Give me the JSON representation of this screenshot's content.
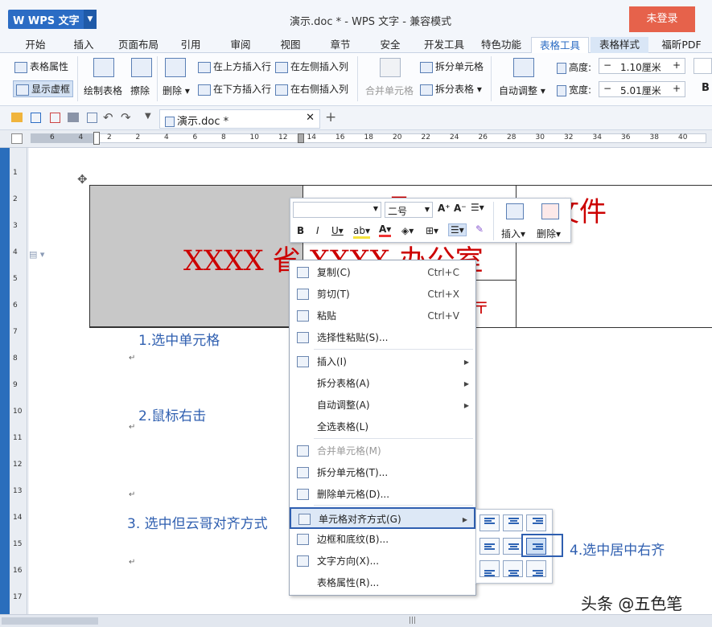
{
  "app": {
    "name": "WPS 文字",
    "document_title": "演示.doc * - WPS 文字 - 兼容模式",
    "login": "未登录"
  },
  "tabs": [
    "开始",
    "插入",
    "页面布局",
    "引用",
    "审阅",
    "视图",
    "章节",
    "安全",
    "开发工具",
    "特色功能",
    "表格工具",
    "表格样式",
    "福昕PDF"
  ],
  "ribbon": {
    "table_props": "表格属性",
    "show_gridlines": "显示虚框",
    "draw_table": "绘制表格",
    "erase": "擦除",
    "delete": "删除",
    "insert_above": "在上方插入行",
    "insert_below": "在下方插入行",
    "insert_left": "在左侧插入列",
    "insert_right": "在右侧插入列",
    "merge_cells": "合并单元格",
    "split_cells": "拆分单元格",
    "split_table": "拆分表格",
    "autofit": "自动调整",
    "height_label": "高度:",
    "height_value": "1.10厘米",
    "width_label": "宽度:",
    "width_value": "5.01厘米"
  },
  "doc_tab": "演示.doc *",
  "ruler": {
    "h": [
      "6",
      "4",
      "2",
      "2",
      "4",
      "6",
      "8",
      "10",
      "12",
      "14",
      "16",
      "18",
      "20",
      "22",
      "24",
      "26",
      "28",
      "30",
      "32",
      "34",
      "36",
      "38",
      "40"
    ],
    "v": [
      "1",
      "2",
      "3",
      "4",
      "5",
      "6",
      "7",
      "8",
      "9",
      "10",
      "11",
      "12",
      "13",
      "14",
      "15",
      "16",
      "17"
    ]
  },
  "document": {
    "cell_main": "XXXX 省 XXXX 办公室",
    "cell_right": "文件"
  },
  "annotations": {
    "step1": "1.选中单元格",
    "step2": "2.鼠标右击",
    "step3": "3. 选中但云哥对齐方式",
    "step4": "4.选中居中右齐"
  },
  "mini_toolbar": {
    "font_size": "二号",
    "insert": "插入",
    "delete": "删除"
  },
  "context_menu": [
    {
      "label": "复制(C)",
      "shortcut": "Ctrl+C",
      "icon": "copy-icon"
    },
    {
      "label": "剪切(T)",
      "shortcut": "Ctrl+X",
      "icon": "cut-icon"
    },
    {
      "label": "粘贴",
      "shortcut": "Ctrl+V",
      "icon": "paste-icon"
    },
    {
      "label": "选择性粘贴(S)...",
      "icon": "paste-special-icon"
    },
    {
      "label": "插入(I)",
      "submenu": true,
      "icon": "table-insert-icon"
    },
    {
      "label": "拆分表格(A)",
      "submenu": true
    },
    {
      "label": "自动调整(A)",
      "submenu": true
    },
    {
      "label": "全选表格(L)"
    },
    {
      "label": "合并单元格(M)",
      "disabled": true,
      "icon": "merge-cells-icon"
    },
    {
      "label": "拆分单元格(T)...",
      "icon": "split-cells-icon"
    },
    {
      "label": "删除单元格(D)...",
      "icon": "delete-cells-icon"
    },
    {
      "label": "单元格对齐方式(G)",
      "submenu": true,
      "highlighted": true,
      "icon": "cell-align-icon"
    },
    {
      "label": "边框和底纹(B)...",
      "icon": "borders-icon"
    },
    {
      "label": "文字方向(X)...",
      "icon": "text-direction-icon"
    },
    {
      "label": "表格属性(R)..."
    }
  ],
  "watermark": "头条 @五色笔"
}
